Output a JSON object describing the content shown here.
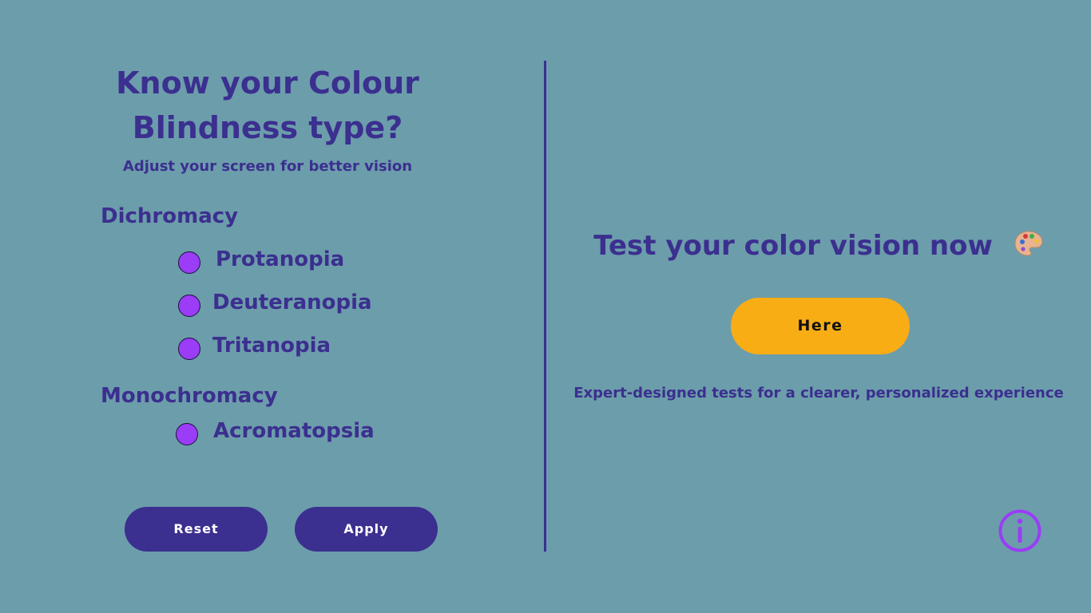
{
  "left_panel": {
    "title": "Know your Colour Blindness type?",
    "subtitle": "Adjust your screen for better vision",
    "groups": [
      {
        "heading": "Dichromacy",
        "options": [
          "Protanopia",
          "Deuteranopia",
          "Tritanopia"
        ]
      },
      {
        "heading": "Monochromacy",
        "options": [
          "Acromatopsia"
        ]
      }
    ],
    "reset_label": "Reset",
    "apply_label": "Apply"
  },
  "right_panel": {
    "title": "Test your color vision now",
    "title_icon": "palette-icon",
    "button_label": "Here",
    "description": "Expert-designed tests for a clearer, personalized experience",
    "info_icon": "info-icon"
  },
  "colors": {
    "background": "#6c9dab",
    "primary": "#3b2f8f",
    "radio_fill": "#9b3cf6",
    "accent_button": "#f8ad15",
    "info_icon": "#9b3cf6"
  }
}
